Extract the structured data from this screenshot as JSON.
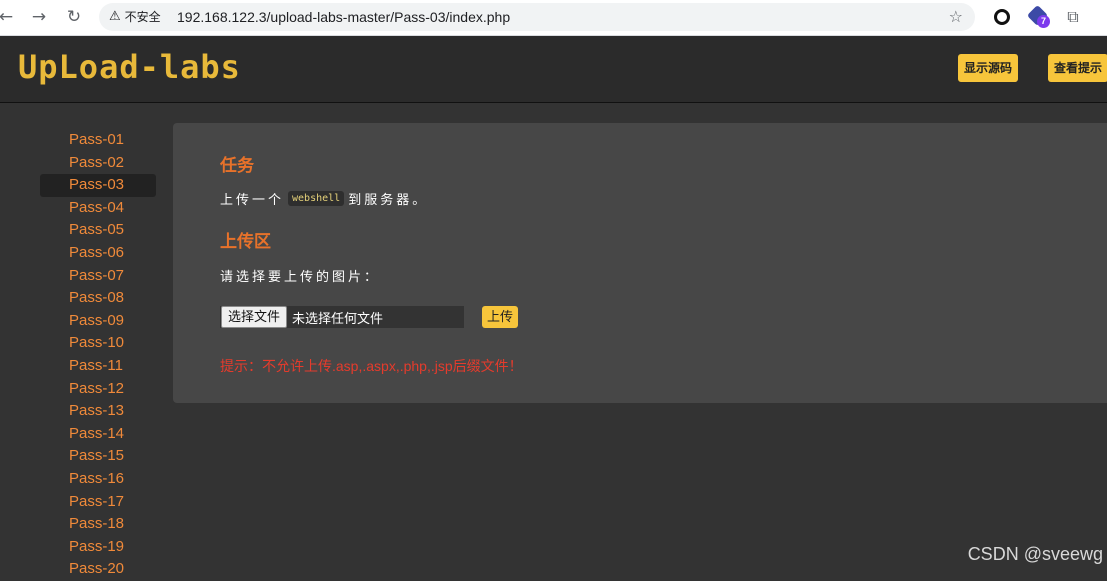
{
  "browser": {
    "security_label": "不安全",
    "url": "192.168.122.3/upload-labs-master/Pass-03/index.php"
  },
  "header": {
    "logo": "UpLoad-labs",
    "show_source_label": "显示源码",
    "show_hint_label": "查看提示"
  },
  "sidebar": {
    "active_index": 2,
    "items": [
      {
        "label": "Pass-01"
      },
      {
        "label": "Pass-02"
      },
      {
        "label": "Pass-03"
      },
      {
        "label": "Pass-04"
      },
      {
        "label": "Pass-05"
      },
      {
        "label": "Pass-06"
      },
      {
        "label": "Pass-07"
      },
      {
        "label": "Pass-08"
      },
      {
        "label": "Pass-09"
      },
      {
        "label": "Pass-10"
      },
      {
        "label": "Pass-11"
      },
      {
        "label": "Pass-12"
      },
      {
        "label": "Pass-13"
      },
      {
        "label": "Pass-14"
      },
      {
        "label": "Pass-15"
      },
      {
        "label": "Pass-16"
      },
      {
        "label": "Pass-17"
      },
      {
        "label": "Pass-18"
      },
      {
        "label": "Pass-19"
      },
      {
        "label": "Pass-20"
      }
    ]
  },
  "main": {
    "task_heading": "任务",
    "task_before": "上传一个",
    "task_code": "webshell",
    "task_after": "到服务器。",
    "upload_heading": "上传区",
    "prompt": "请选择要上传的图片：",
    "choose_file_label": "选择文件",
    "no_file_text": "未选择任何文件",
    "upload_label": "上传",
    "hint": "提示：不允许上传.asp,.aspx,.php,.jsp后缀文件！"
  },
  "watermark": "CSDN @sveewg",
  "colors": {
    "accent": "#f7c53b",
    "heading": "#e8722a",
    "link": "#f08a3a",
    "error": "#e53b2c",
    "background": "#333333",
    "panel": "#474747"
  }
}
